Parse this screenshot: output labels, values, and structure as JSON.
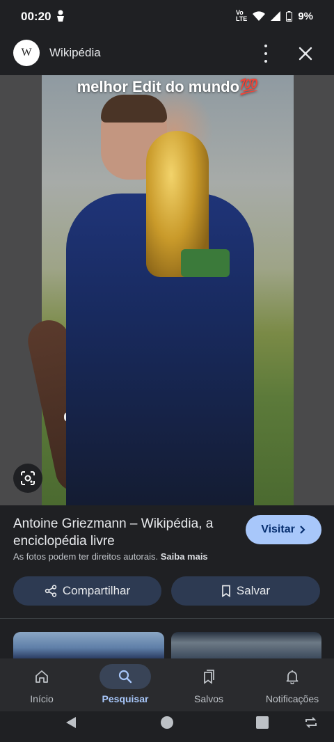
{
  "status_bar": {
    "time": "00:20",
    "battery": "9%"
  },
  "header": {
    "site_name": "Wikipédia",
    "logo_letter": "W"
  },
  "image": {
    "overlay_text": "melhor Edit do mundo💯"
  },
  "result": {
    "title": "Antoine Griezmann – Wikipédia, a enciclopédia livre",
    "visit_label": "Visitar",
    "rights_text": "As fotos podem ter direitos autorais.",
    "learn_more": "Saiba mais"
  },
  "actions": {
    "share_label": "Compartilhar",
    "save_label": "Salvar"
  },
  "bottom_nav": [
    {
      "label": "Início",
      "icon": "home-icon"
    },
    {
      "label": "Pesquisar",
      "icon": "search-icon",
      "active": true
    },
    {
      "label": "Salvos",
      "icon": "bookmarks-icon"
    },
    {
      "label": "Notificações",
      "icon": "bell-icon"
    }
  ],
  "colors": {
    "background": "#1f2023",
    "accent": "#a8c7fa",
    "pill": "#2d3a52"
  }
}
